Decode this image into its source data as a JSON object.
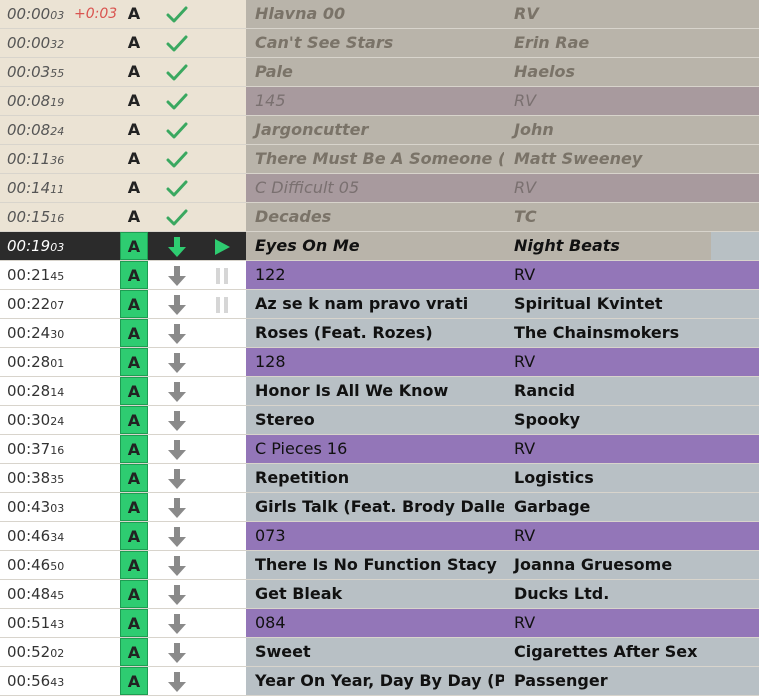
{
  "colors": {
    "played_bg": "#ebe3d4",
    "played_track_bg": "#b9b4aa",
    "played_jingle_bg": "#a89a9e",
    "current_bg": "#2b2b2b",
    "upcoming_track_bg": "#b8c0c5",
    "upcoming_jingle_bg": "#9376b8",
    "mode_badge": "#2ecc71",
    "check_icon": "#3aa860",
    "offset_text": "#d9534f"
  },
  "rows": [
    {
      "status": "played",
      "time": "00:00",
      "frac": "03",
      "offset": "+0:03",
      "mode": "A",
      "icon": "check-icon",
      "state_icon": "",
      "title": "Hlavna 00",
      "artist": "RV",
      "kind": "track"
    },
    {
      "status": "played",
      "time": "00:00",
      "frac": "32",
      "offset": "",
      "mode": "A",
      "icon": "check-icon",
      "state_icon": "",
      "title": "Can't See Stars",
      "artist": "Erin Rae",
      "kind": "track"
    },
    {
      "status": "played",
      "time": "00:03",
      "frac": "55",
      "offset": "",
      "mode": "A",
      "icon": "check-icon",
      "state_icon": "",
      "title": "Pale",
      "artist": "Haelos",
      "kind": "track"
    },
    {
      "status": "played",
      "time": "00:08",
      "frac": "19",
      "offset": "",
      "mode": "A",
      "icon": "check-icon",
      "state_icon": "",
      "title": "145",
      "artist": "RV",
      "kind": "jingle"
    },
    {
      "status": "played",
      "time": "00:08",
      "frac": "24",
      "offset": "",
      "mode": "A",
      "icon": "check-icon",
      "state_icon": "",
      "title": "Jargoncutter",
      "artist": "John",
      "kind": "track"
    },
    {
      "status": "played",
      "time": "00:11",
      "frac": "36",
      "offset": "",
      "mode": "A",
      "icon": "check-icon",
      "state_icon": "",
      "title": "There Must Be A Someone (F...",
      "artist": "Matt Sweeney",
      "kind": "track"
    },
    {
      "status": "played",
      "time": "00:14",
      "frac": "11",
      "offset": "",
      "mode": "A",
      "icon": "check-icon",
      "state_icon": "",
      "title": "C Difficult 05",
      "artist": "RV",
      "kind": "jingle"
    },
    {
      "status": "played",
      "time": "00:15",
      "frac": "16",
      "offset": "",
      "mode": "A",
      "icon": "check-icon",
      "state_icon": "",
      "title": "Decades",
      "artist": "TC",
      "kind": "track"
    },
    {
      "status": "current",
      "time": "00:19",
      "frac": "03",
      "offset": "",
      "mode": "A",
      "icon": "arrow-down-icon",
      "state_icon": "play-icon",
      "title": "Eyes On Me",
      "artist": "Night Beats",
      "kind": "track"
    },
    {
      "status": "upcoming",
      "time": "00:21",
      "frac": "45",
      "offset": "",
      "mode": "A",
      "icon": "arrow-down-icon",
      "state_icon": "pause-icon",
      "title": "122",
      "artist": "RV",
      "kind": "jingle"
    },
    {
      "status": "upcoming",
      "time": "00:22",
      "frac": "07",
      "offset": "",
      "mode": "A",
      "icon": "arrow-down-icon",
      "state_icon": "pause-icon",
      "title": "Az se k nam pravo vrati",
      "artist": "Spiritual Kvintet",
      "kind": "track"
    },
    {
      "status": "upcoming",
      "time": "00:24",
      "frac": "30",
      "offset": "",
      "mode": "A",
      "icon": "arrow-down-icon",
      "state_icon": "",
      "title": "Roses (Feat. Rozes)",
      "artist": "The Chainsmokers",
      "kind": "track"
    },
    {
      "status": "upcoming",
      "time": "00:28",
      "frac": "01",
      "offset": "",
      "mode": "A",
      "icon": "arrow-down-icon",
      "state_icon": "",
      "title": "128",
      "artist": "RV",
      "kind": "jingle"
    },
    {
      "status": "upcoming",
      "time": "00:28",
      "frac": "14",
      "offset": "",
      "mode": "A",
      "icon": "arrow-down-icon",
      "state_icon": "",
      "title": "Honor Is All We Know",
      "artist": "Rancid",
      "kind": "track"
    },
    {
      "status": "upcoming",
      "time": "00:30",
      "frac": "24",
      "offset": "",
      "mode": "A",
      "icon": "arrow-down-icon",
      "state_icon": "",
      "title": "Stereo",
      "artist": "Spooky",
      "kind": "track"
    },
    {
      "status": "upcoming",
      "time": "00:37",
      "frac": "16",
      "offset": "",
      "mode": "A",
      "icon": "arrow-down-icon",
      "state_icon": "",
      "title": "C Pieces 16",
      "artist": "RV",
      "kind": "jingle"
    },
    {
      "status": "upcoming",
      "time": "00:38",
      "frac": "35",
      "offset": "",
      "mode": "A",
      "icon": "arrow-down-icon",
      "state_icon": "",
      "title": "Repetition",
      "artist": "Logistics",
      "kind": "track"
    },
    {
      "status": "upcoming",
      "time": "00:43",
      "frac": "03",
      "offset": "",
      "mode": "A",
      "icon": "arrow-down-icon",
      "state_icon": "",
      "title": "Girls Talk (Feat. Brody Dalle)",
      "artist": "Garbage",
      "kind": "track"
    },
    {
      "status": "upcoming",
      "time": "00:46",
      "frac": "34",
      "offset": "",
      "mode": "A",
      "icon": "arrow-down-icon",
      "state_icon": "",
      "title": "073",
      "artist": "RV",
      "kind": "jingle"
    },
    {
      "status": "upcoming",
      "time": "00:46",
      "frac": "50",
      "offset": "",
      "mode": "A",
      "icon": "arrow-down-icon",
      "state_icon": "",
      "title": "There Is No Function Stacy",
      "artist": "Joanna Gruesome",
      "kind": "track"
    },
    {
      "status": "upcoming",
      "time": "00:48",
      "frac": "45",
      "offset": "",
      "mode": "A",
      "icon": "arrow-down-icon",
      "state_icon": "",
      "title": "Get Bleak",
      "artist": "Ducks Ltd.",
      "kind": "track"
    },
    {
      "status": "upcoming",
      "time": "00:51",
      "frac": "43",
      "offset": "",
      "mode": "A",
      "icon": "arrow-down-icon",
      "state_icon": "",
      "title": "084",
      "artist": "RV",
      "kind": "jingle"
    },
    {
      "status": "upcoming",
      "time": "00:52",
      "frac": "02",
      "offset": "",
      "mode": "A",
      "icon": "arrow-down-icon",
      "state_icon": "",
      "title": "Sweet",
      "artist": "Cigarettes After Sex",
      "kind": "track"
    },
    {
      "status": "upcoming",
      "time": "00:56",
      "frac": "43",
      "offset": "",
      "mode": "A",
      "icon": "arrow-down-icon",
      "state_icon": "",
      "title": "Year On Year, Day By Day (P...",
      "artist": "Passenger",
      "kind": "track"
    }
  ]
}
